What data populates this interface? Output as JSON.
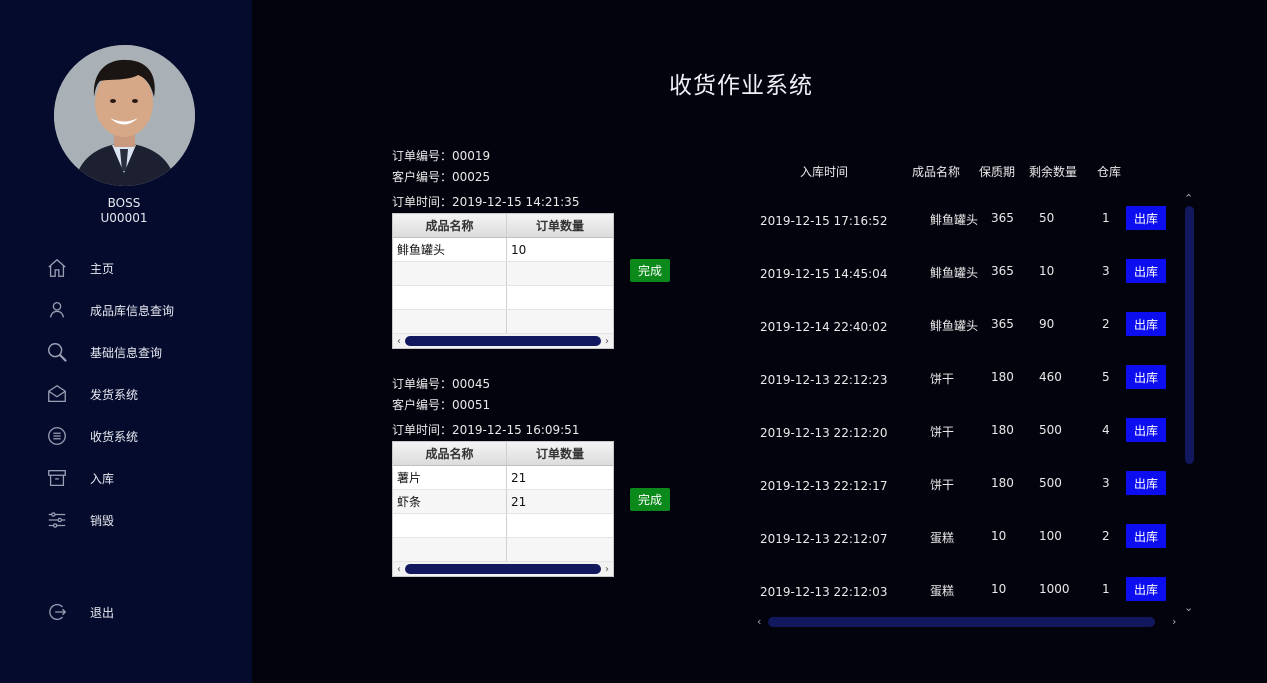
{
  "user": {
    "name": "BOSS",
    "id": "U00001"
  },
  "nav": [
    {
      "label": "主页",
      "icon": "home-icon"
    },
    {
      "label": "成品库信息查询",
      "icon": "user-icon"
    },
    {
      "label": "基础信息查询",
      "icon": "search-icon"
    },
    {
      "label": "发货系统",
      "icon": "mail-icon"
    },
    {
      "label": "收货系统",
      "icon": "list-circle-icon"
    },
    {
      "label": "入库",
      "icon": "archive-icon"
    },
    {
      "label": "销毁",
      "icon": "sliders-icon"
    }
  ],
  "logout": {
    "label": "退出",
    "icon": "logout-icon"
  },
  "page_title": "收货作业系统",
  "orders": [
    {
      "order_no": "订单编号：00019",
      "customer_no": "客户编号：00025",
      "order_time": "订单时间：2019-12-15 14:21:35",
      "headers": [
        "成品名称",
        "订单数量"
      ],
      "rows": [
        [
          "鲱鱼罐头",
          "10"
        ],
        [
          "",
          ""
        ],
        [
          "",
          ""
        ],
        [
          "",
          ""
        ]
      ],
      "done_label": "完成"
    },
    {
      "order_no": "订单编号：00045",
      "customer_no": "客户编号：00051",
      "order_time": "订单时间：2019-12-15 16:09:51",
      "headers": [
        "成品名称",
        "订单数量"
      ],
      "rows": [
        [
          "薯片",
          "21"
        ],
        [
          "虾条",
          "21"
        ],
        [
          "",
          ""
        ],
        [
          "",
          ""
        ]
      ],
      "done_label": "完成"
    }
  ],
  "stock": {
    "headers": [
      "入库时间",
      "成品名称",
      "保质期",
      "剩余数量",
      "仓库"
    ],
    "button_label": "出库",
    "rows": [
      {
        "time": "2019-12-15 17:16:52",
        "name": "鲱鱼罐头",
        "shelf": "365",
        "qty": "50",
        "wh": "1"
      },
      {
        "time": "2019-12-15 14:45:04",
        "name": "鲱鱼罐头",
        "shelf": "365",
        "qty": "10",
        "wh": "3"
      },
      {
        "time": "2019-12-14 22:40:02",
        "name": "鲱鱼罐头",
        "shelf": "365",
        "qty": "90",
        "wh": "2"
      },
      {
        "time": "2019-12-13 22:12:23",
        "name": "饼干",
        "shelf": "180",
        "qty": "460",
        "wh": "5"
      },
      {
        "time": "2019-12-13 22:12:20",
        "name": "饼干",
        "shelf": "180",
        "qty": "500",
        "wh": "4"
      },
      {
        "time": "2019-12-13 22:12:17",
        "name": "饼干",
        "shelf": "180",
        "qty": "500",
        "wh": "3"
      },
      {
        "time": "2019-12-13 22:12:07",
        "name": "蛋糕",
        "shelf": "10",
        "qty": "100",
        "wh": "2"
      },
      {
        "time": "2019-12-13 22:12:03",
        "name": "蛋糕",
        "shelf": "10",
        "qty": "1000",
        "wh": "1"
      }
    ]
  },
  "colors": {
    "sidebar": "#050b2c",
    "background": "#03030d",
    "done": "#0b8a1b",
    "out": "#0d0ef0",
    "scroll": "#12185e"
  }
}
